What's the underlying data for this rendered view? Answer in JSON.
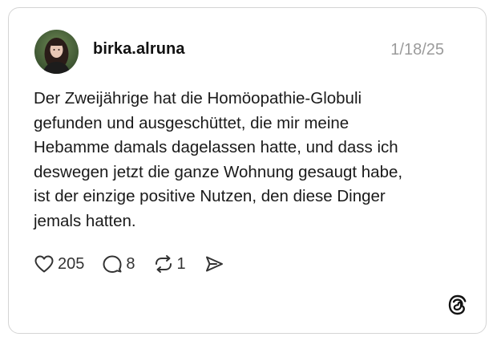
{
  "post": {
    "username": "birka.alruna",
    "date": "1/18/25",
    "text": "Der Zweijährige hat die Homöopathie-Globuli\ngefunden und ausgeschüttet, die mir meine\nHebamme damals dagelassen hatte, und dass ich\ndeswegen jetzt die ganze Wohnung gesaugt habe,\nist der einzige positive Nutzen, den diese Dinger\njemals hatten."
  },
  "actions": {
    "likes": "205",
    "replies": "8",
    "reposts": "1"
  },
  "icons": {
    "like": "heart-icon",
    "reply": "comment-icon",
    "repost": "repost-icon",
    "share": "share-icon",
    "brand": "threads-logo"
  },
  "colors": {
    "text": "#1a1a1a",
    "muted": "#9b9b9b",
    "border": "#d4d4d4"
  }
}
